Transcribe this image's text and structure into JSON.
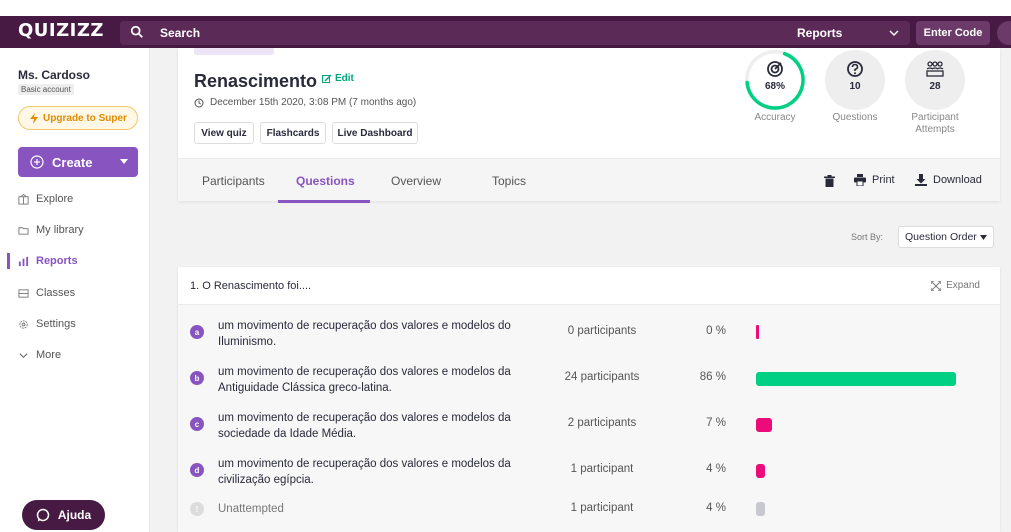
{
  "topbar": {
    "logo": "QUIZIZZ",
    "search_label": "Search",
    "reports_select": "Reports",
    "enter_code": "Enter Code"
  },
  "sidebar": {
    "teacher_name": "Ms. Cardoso",
    "account_type": "Basic account",
    "upgrade_label": "Upgrade to Super",
    "create_label": "Create",
    "items": [
      {
        "label": "Explore",
        "icon": "explore-icon"
      },
      {
        "label": "My library",
        "icon": "folder-icon"
      },
      {
        "label": "Reports",
        "icon": "reports-icon",
        "active": true
      },
      {
        "label": "Classes",
        "icon": "classes-icon"
      },
      {
        "label": "Settings",
        "icon": "gear-icon"
      },
      {
        "label": "More",
        "icon": "chevron-down-icon"
      }
    ],
    "help_label": "Ajuda"
  },
  "header": {
    "title": "Renascimento",
    "edit_label": "Edit",
    "date": "December 15th 2020, 3:08 PM (7 months ago)",
    "buttons": [
      "View quiz",
      "Flashcards",
      "Live Dashboard"
    ],
    "stats": [
      {
        "value": "68%",
        "label": "Accuracy",
        "icon": "target-icon",
        "progress": 0.68
      },
      {
        "value": "10",
        "label": "Questions",
        "icon": "question-icon"
      },
      {
        "value": "28",
        "label": "Participant Attempts",
        "icon": "participants-icon"
      }
    ],
    "tabs": [
      "Participants",
      "Questions",
      "Overview",
      "Topics"
    ],
    "active_tab": "Questions",
    "print_label": "Print",
    "download_label": "Download"
  },
  "sort": {
    "label": "Sort By:",
    "value": "Question Order"
  },
  "question": {
    "title": "1. O Renascimento foi....",
    "expand_label": "Expand",
    "options": [
      {
        "letter": "a",
        "text": "um movimento de recuperação dos valores e modelos do Iluminismo.",
        "count": "0 participants",
        "pct": "0 %",
        "fraction": 0.0,
        "color": "#ec0b7b"
      },
      {
        "letter": "b",
        "text": "um movimento de recuperação dos valores e modelos da Antiguidade Clássica greco-latina.",
        "count": "24 participants",
        "pct": "86 %",
        "fraction": 0.86,
        "color": "#00d084"
      },
      {
        "letter": "c",
        "text": "um movimento de recuperação dos valores e modelos da sociedade da Idade Média.",
        "count": "2 participants",
        "pct": "7 %",
        "fraction": 0.07,
        "color": "#ec0b7b"
      },
      {
        "letter": "d",
        "text": "um movimento de recuperação dos valores e modelos da civilização egípcia.",
        "count": "1 participant",
        "pct": "4 %",
        "fraction": 0.04,
        "color": "#ec0b7b"
      },
      {
        "letter": "!",
        "text": "Unattempted",
        "count": "1 participant",
        "pct": "4 %",
        "fraction": 0.04,
        "color": "#c8c8d0",
        "unattempted": true
      }
    ]
  }
}
